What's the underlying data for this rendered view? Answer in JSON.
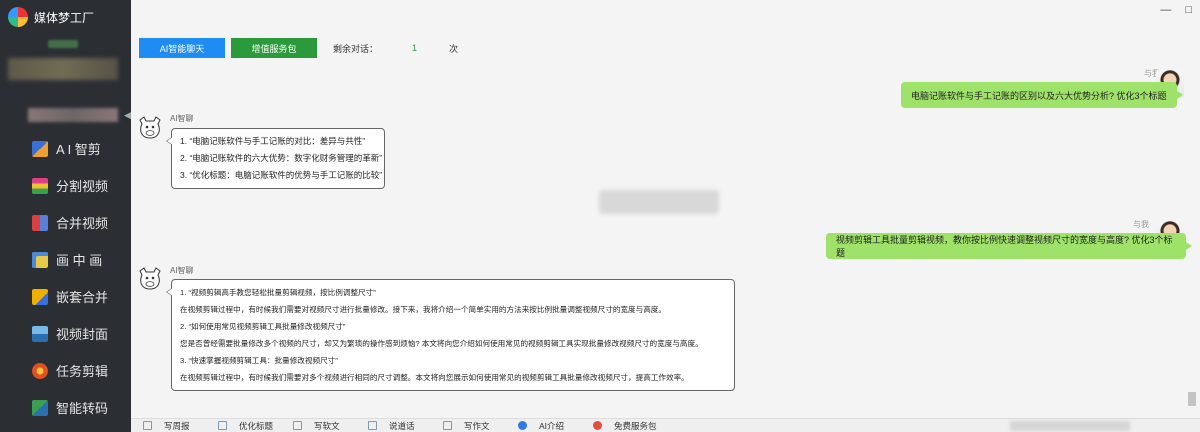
{
  "app": {
    "name": "媒体梦工厂"
  },
  "sidebar": {
    "items": [
      {
        "label": "A I 智剪",
        "icon": "ai-edit-icon",
        "color": "#f0a030"
      },
      {
        "label": "分割视频",
        "icon": "split-video-icon",
        "color": "#e0408a"
      },
      {
        "label": "合并视频",
        "icon": "merge-video-icon",
        "color": "#d94040"
      },
      {
        "label": "画 中 画",
        "icon": "picture-in-picture-icon",
        "color": "#e6c84a"
      },
      {
        "label": "嵌套合并",
        "icon": "nested-merge-icon",
        "color": "#f0b000"
      },
      {
        "label": "视频封面",
        "icon": "video-cover-icon",
        "color": "#3a90d0"
      },
      {
        "label": "任务剪辑",
        "icon": "task-edit-icon",
        "color": "#e05020"
      },
      {
        "label": "智能转码",
        "icon": "transcode-icon",
        "color": "#3aa050"
      }
    ]
  },
  "toolbar": {
    "ai_chat_label": "AI智能聊天",
    "value_pack_label": "增值服务包",
    "remain_label": "剩余对话：",
    "remain_count": "1",
    "remain_unit": "次"
  },
  "chat": {
    "user_name": "与我",
    "ai_name": "AI智聊",
    "messages": [
      {
        "from": "user",
        "text": "电脑记账软件与手工记账的区别以及六大优势分析? 优化3个标题"
      },
      {
        "from": "ai",
        "lines": [
          "1.  “电脑记账软件与手工记账的对比：差异与共性”",
          "2.  “电脑记账软件的六大优势：数字化财务管理的革新”",
          "3.  “优化标题：电脑记账软件的优势与手工记账的比较”"
        ]
      },
      {
        "from": "user",
        "text": "视频剪辑工具批量剪辑视频，教你按比例快速调整视频尺寸的宽度与高度? 优化3个标题"
      },
      {
        "from": "ai",
        "lines": [
          "1.  “视频剪辑高手教您轻松批量剪辑视频，按比例调整尺寸”",
          "在视频剪辑过程中，有时候我们需要对视频尺寸进行批量修改。接下来，我将介绍一个简单实用的方法来按比例批量调整视频尺寸的宽度与高度。",
          "2.  “如何使用常见视频剪辑工具批量修改视频尺寸”",
          "您是否曾经需要批量修改多个视频的尺寸，却又为繁琐的操作感到烦恼? 本文将向您介绍如何使用常见的视频剪辑工具实现批量修改视频尺寸的宽度与高度。",
          "3.  “快速掌握视频剪辑工具：批量修改视频尺寸”",
          "在视频剪辑过程中，有时候我们需要对多个视频进行相同的尺寸调整。本文将向您展示如何使用常见的视频剪辑工具批量修改视频尺寸，提高工作效率。"
        ]
      }
    ]
  },
  "bottom": {
    "items": [
      {
        "label": "写周报",
        "icon": "report-icon"
      },
      {
        "label": "优化标题",
        "icon": "title-icon"
      },
      {
        "label": "写软文",
        "icon": "article-icon"
      },
      {
        "label": "说道话",
        "icon": "speech-icon"
      },
      {
        "label": "写作文",
        "icon": "essay-icon"
      },
      {
        "label": "AI介绍",
        "icon": "info-icon"
      },
      {
        "label": "免费服务包",
        "icon": "gift-icon"
      }
    ]
  },
  "window": {
    "minimize": "—",
    "maximize": "□"
  }
}
